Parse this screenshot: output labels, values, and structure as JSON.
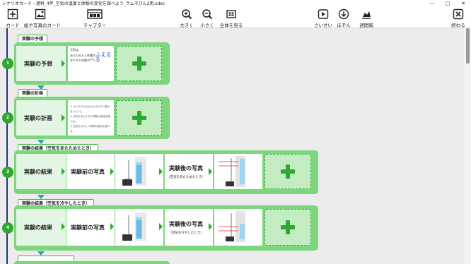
{
  "window": {
    "title": "シナリオカード - 理科_4年_空気の温度と体積の変化を調べよう_ラムネびん2用.sdec",
    "minimize": "－",
    "maximize": "□",
    "close": "✕"
  },
  "toolbar": {
    "card_label": "カード",
    "picture_card_label": "絵や写真のカード",
    "chapter_label": "チャプター",
    "zoom_in_label": "大きく",
    "zoom_out_label": "小さく",
    "fit_all_label": "全体を見る",
    "play_label": "さいせい",
    "save_label": "ほぞん",
    "upload_label": "週間報",
    "exit_label": "終わる"
  },
  "colors": {
    "accent_green": "#2fa82f",
    "section_bg": "#7dd67d",
    "timeline": "#1e3c78",
    "arrow_teal": "#2aa5a5",
    "note_blue": "#1d55c9"
  },
  "sections": [
    {
      "number": "1",
      "title": "実験の予想",
      "card_label": "実験の予想",
      "note_line1": "空気は、",
      "note_line2a": "あたためると体積が",
      "note_big1": "ふえる",
      "note_line3a": "冷やすと体積が",
      "note_big2": "へる"
    },
    {
      "number": "2",
      "title": "実験の計画",
      "card_label": "実験の計画",
      "bullets": [
        "① ラムネびんのせんが上の方へ動かないように",
        "② 空気をあたためて体積の変化を調べる。",
        "③ 空気を冷やして体積の変化を調べる。"
      ]
    },
    {
      "number": "3",
      "title": "実験の結果（空気をあたためたとき）",
      "card_label": "実験の結果",
      "before_label": "実験前の写真",
      "after_label": "実験後の写真",
      "after_sub": "（空気をあたためたとき）"
    },
    {
      "number": "4",
      "title": "実験の結果（空気を冷やしたとき）",
      "card_label": "実験の結果",
      "before_label": "実験前の写真",
      "after_label": "実験後の写真",
      "after_sub": "（空気を冷やしたとき）"
    }
  ]
}
